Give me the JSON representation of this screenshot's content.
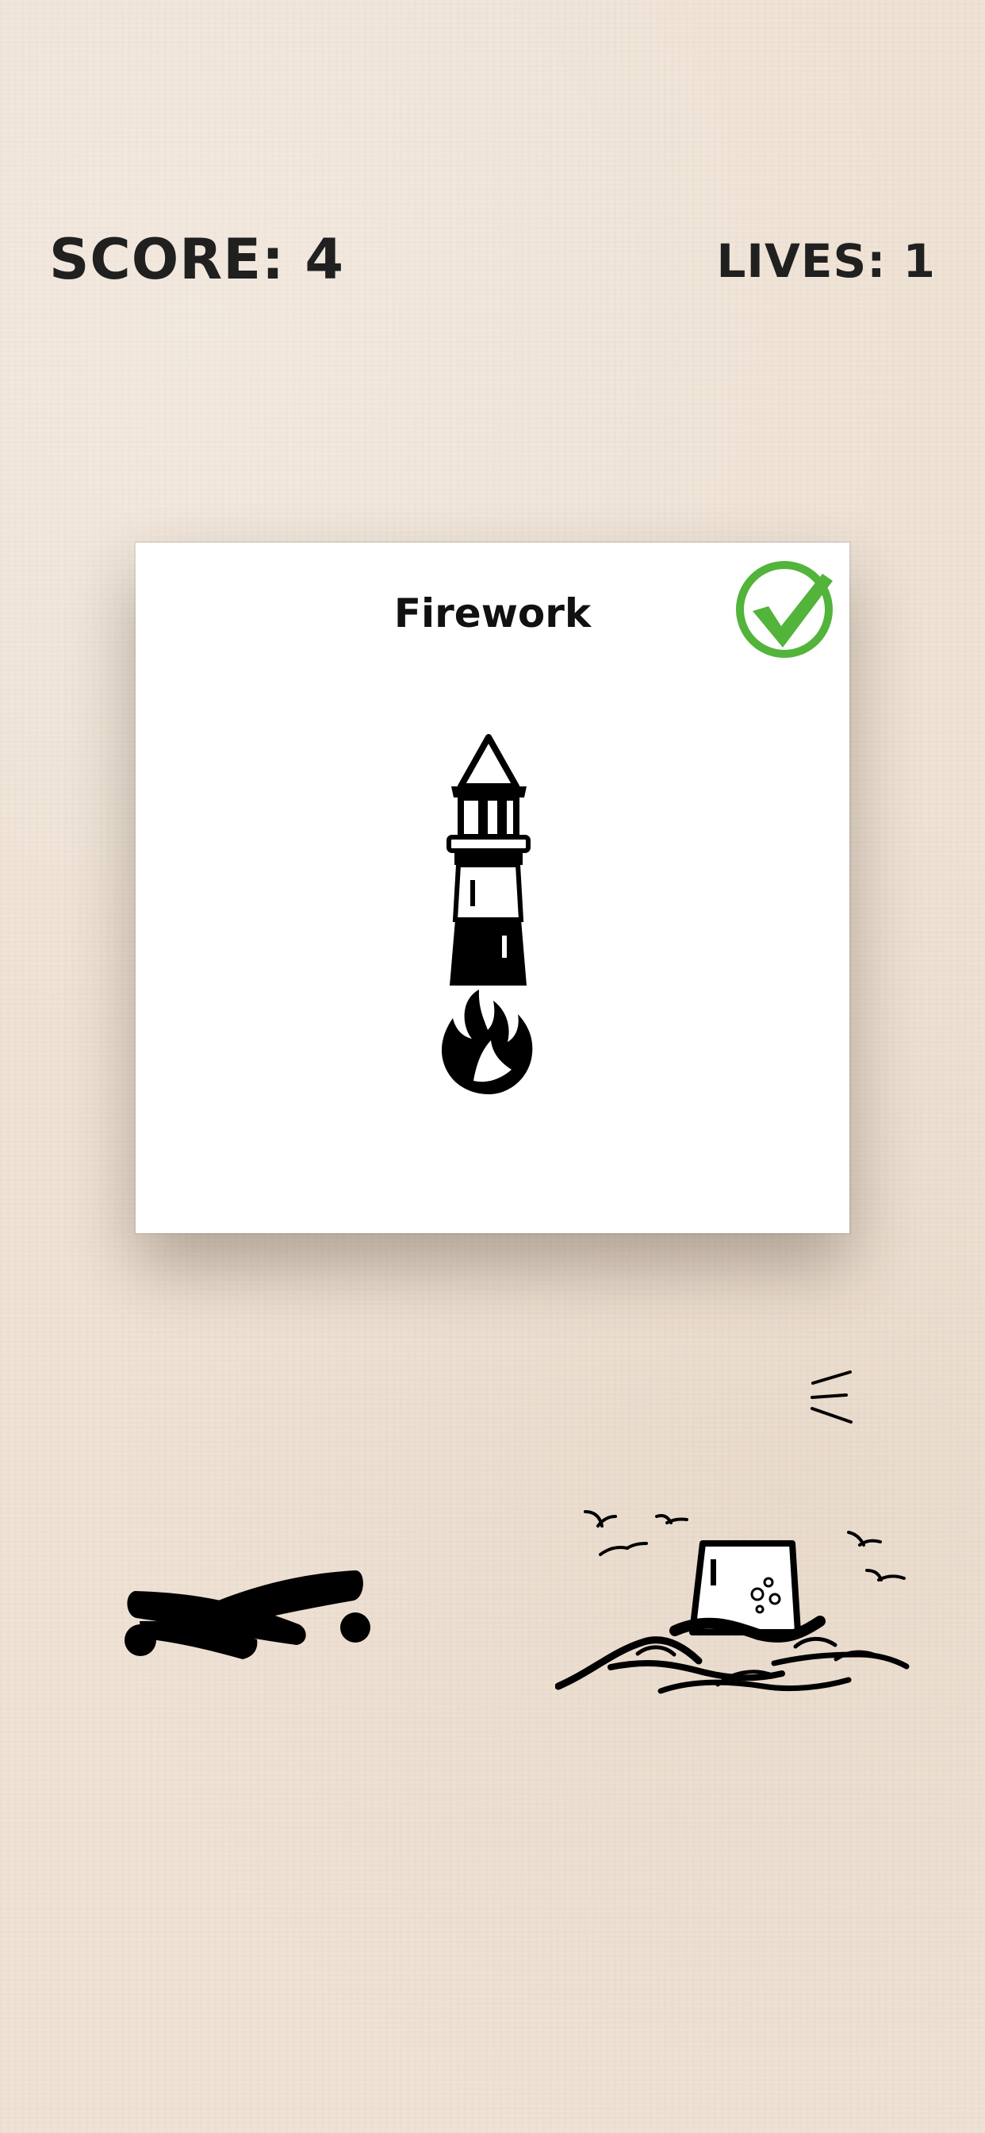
{
  "hud": {
    "score_text": "SCORE: 4",
    "lives_text": "LIVES: 1"
  },
  "card": {
    "title": "Firework",
    "status_icon": "checkmark-circle-icon",
    "status_color": "#52b43a",
    "image_icon": "lighthouse-firework-icon"
  },
  "choices": [
    {
      "icon": "crossed-logs-icon"
    },
    {
      "icon": "bucket-on-waves-icon"
    }
  ],
  "decor": {
    "icon": "motion-lines-icon"
  }
}
